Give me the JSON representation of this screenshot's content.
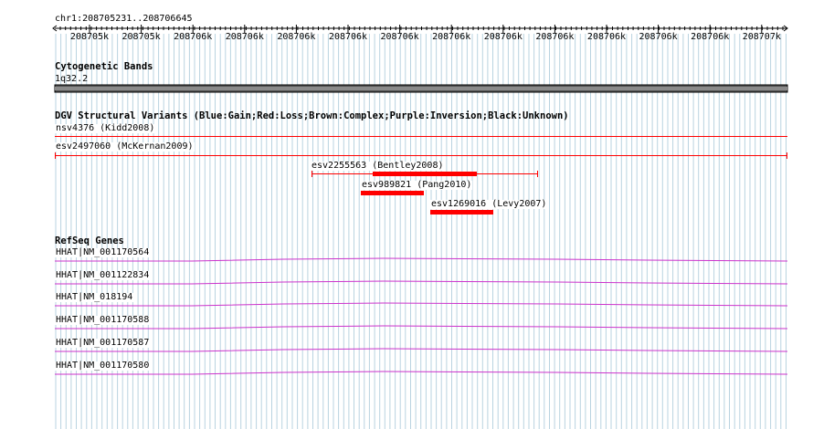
{
  "ruler": {
    "location": "chr1:208705231..208706645",
    "ticks": [
      "208705k",
      "208705k",
      "208706k",
      "208706k",
      "208706k",
      "208706k",
      "208706k",
      "208706k",
      "208706k",
      "208706k",
      "208706k",
      "208706k",
      "208706k",
      "208707k"
    ]
  },
  "tracks": {
    "cytoband": {
      "title": "Cytogenetic Bands",
      "band": "1q32.2"
    },
    "dgv": {
      "title": "DGV Structural Variants (Blue:Gain;Red:Loss;Brown:Complex;Purple:Inversion;Black:Unknown)",
      "variants": [
        "nsv4376 (Kidd2008)",
        "esv2497060 (McKernan2009)",
        "esv2255563 (Bentley2008)",
        "esv989821 (Pang2010)",
        "esv1269016 (Levy2007)"
      ]
    },
    "refseq": {
      "title": "RefSeq Genes",
      "genes": [
        "HHAT|NM_001170564",
        "HHAT|NM_001122834",
        "HHAT|NM_018194",
        "HHAT|NM_001170588",
        "HHAT|NM_001170587",
        "HHAT|NM_001170580"
      ]
    }
  },
  "colors": {
    "grid": "#b9d3e0",
    "loss": "#ff0000",
    "gene": "#cc33cc",
    "cytoband": "#555555"
  }
}
